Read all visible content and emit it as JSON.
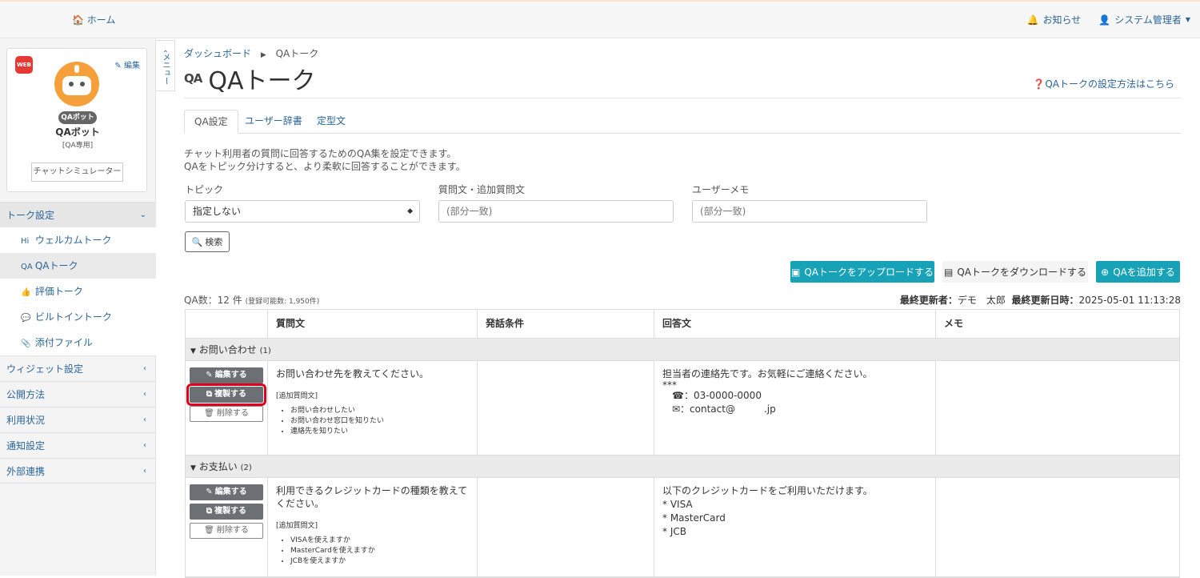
{
  "topbar": {
    "home": "ホーム",
    "notice": "お知らせ",
    "user": "システム管理者"
  },
  "bot": {
    "web_badge": "WEB",
    "edit": "編集",
    "tag": "QAボット",
    "name": "QAボット",
    "sub": "[QA専用]",
    "simulator": "チャットシミュレーター"
  },
  "menu_tab": "メニュー",
  "nav": {
    "talk_settings": "トーク設定",
    "welcome": "ウェルカムトーク",
    "qa": "QAトーク",
    "rating": "評価トーク",
    "builtin": "ビルトイントーク",
    "attachments": "添付ファイル",
    "widget": "ウィジェット設定",
    "publish": "公開方法",
    "usage": "利用状況",
    "notify": "通知設定",
    "external": "外部連携"
  },
  "breadcrumb": {
    "dashboard": "ダッシュボード",
    "current": "QAトーク"
  },
  "page": {
    "title": "QAトーク",
    "icon_text": "QA",
    "help": "QAトークの設定方法はこちら"
  },
  "tabs": [
    "QA設定",
    "ユーザー辞書",
    "定型文"
  ],
  "description": [
    "チャット利用者の質問に回答するためのQA集を設定できます。",
    "QAをトピック分けすると、より柔軟に回答することができます。"
  ],
  "filters": {
    "topic_label": "トピック",
    "topic_value": "指定しない",
    "question_label": "質問文・追加質問文",
    "question_placeholder": "(部分一致)",
    "memo_label": "ユーザーメモ",
    "memo_placeholder": "(部分一致)",
    "search": "検索"
  },
  "actions": {
    "upload": "QAトークをアップロードする",
    "download": "QAトークをダウンロードする",
    "add": "QAを追加する"
  },
  "stats": {
    "count": "QA数：12 件",
    "capacity": "(登録可能数: 1,950件)",
    "updated_by_label": "最終更新者：",
    "updated_by": "デモ　太郎",
    "updated_at_label": "最終更新日時：",
    "updated_at": "2025-05-01 11:13:28"
  },
  "table": {
    "headers": [
      "",
      "質問文",
      "発話条件",
      "回答文",
      "メモ"
    ],
    "btn_edit": "編集する",
    "btn_copy": "複製する",
    "btn_delete": "削除する",
    "additional_label": "[追加質問文]",
    "groups": [
      {
        "name": "お問い合わせ",
        "count": "(1)",
        "rows": [
          {
            "question": "お問い合わせ先を教えてください。",
            "additional": [
              "お問い合わせしたい",
              "お問い合わせ窓口を知りたい",
              "連絡先を知りたい"
            ],
            "answer": [
              "担当者の連絡先です。お気軽にご連絡ください。",
              "***",
              "　☎：03-0000-0000",
              "　✉：contact@　　　.jp"
            ]
          }
        ]
      },
      {
        "name": "お支払い",
        "count": "(2)",
        "rows": [
          {
            "question": "利用できるクレジットカードの種類を教えてください。",
            "additional": [
              "VISAを使えますか",
              "MasterCardを使えますか",
              "JCBを使えますか"
            ],
            "answer": [
              "以下のクレジットカードをご利用いただけます。",
              "* VISA",
              "* MasterCard",
              "* JCB"
            ]
          }
        ]
      }
    ]
  },
  "colors": {
    "link": "#2a6496",
    "teal": "#17a2b8",
    "highlight": "#e0001b",
    "robot": "#f6a03c"
  }
}
